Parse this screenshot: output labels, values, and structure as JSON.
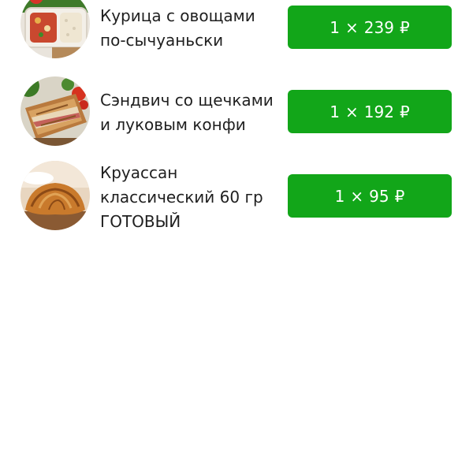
{
  "cart": {
    "items": [
      {
        "name_lines": [
          "Курица с овощами",
          "по-сычуаньски"
        ],
        "image": "chicken-vegetables-container-image",
        "qty": "1",
        "times": "×",
        "price": "239",
        "currency": "₽"
      },
      {
        "name_lines": [
          "Сэндвич со щечками",
          "и луковым конфи"
        ],
        "image": "sandwich-image",
        "qty": "1",
        "times": "×",
        "price": "192",
        "currency": "₽"
      },
      {
        "name_lines": [
          "Круассан",
          "классический 60 гр",
          "ГОТОВЫЙ"
        ],
        "image": "croissant-image",
        "qty": "1",
        "times": "×",
        "price": "95",
        "currency": "₽"
      }
    ]
  },
  "colors": {
    "button_green": "#12a619",
    "button_text": "#ffffff",
    "text_primary": "#1f1f1f",
    "background": "#ffffff"
  }
}
